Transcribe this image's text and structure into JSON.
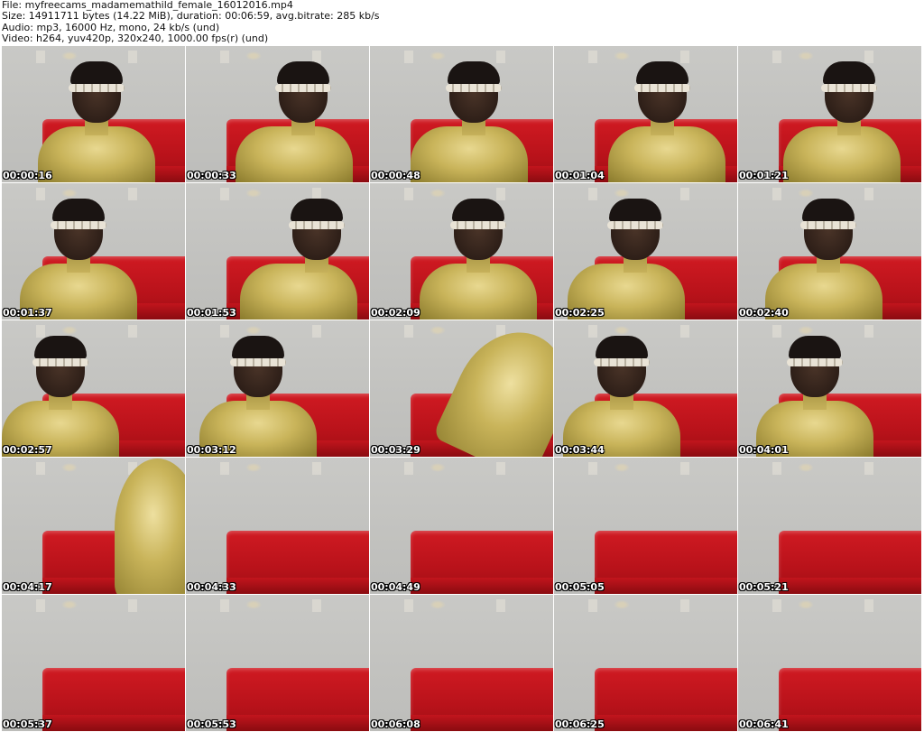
{
  "header": {
    "file_line": "File: myfreecams_madamemathild_female_16012016.mp4",
    "size_line": "Size: 14911711 bytes (14.22 MiB), duration: 00:06:59, avg.bitrate: 285 kb/s",
    "audio_line": "Audio: mp3, 16000 Hz, mono, 24 kb/s (und)",
    "video_line": "Video: h264, yuv420p, 320x240, 1000.00 fps(r) (und)"
  },
  "thumbnails": [
    {
      "time": "00:00:16",
      "scene": "person"
    },
    {
      "time": "00:00:33",
      "scene": "person"
    },
    {
      "time": "00:00:48",
      "scene": "person"
    },
    {
      "time": "00:01:04",
      "scene": "person"
    },
    {
      "time": "00:01:21",
      "scene": "person"
    },
    {
      "time": "00:01:37",
      "scene": "person"
    },
    {
      "time": "00:01:53",
      "scene": "person"
    },
    {
      "time": "00:02:09",
      "scene": "person"
    },
    {
      "time": "00:02:25",
      "scene": "person"
    },
    {
      "time": "00:02:40",
      "scene": "person"
    },
    {
      "time": "00:02:57",
      "scene": "person"
    },
    {
      "time": "00:03:12",
      "scene": "person"
    },
    {
      "time": "00:03:29",
      "scene": "gold-closeup"
    },
    {
      "time": "00:03:44",
      "scene": "person"
    },
    {
      "time": "00:04:01",
      "scene": "person"
    },
    {
      "time": "00:04:17",
      "scene": "gold-closeup"
    },
    {
      "time": "00:04:33",
      "scene": "empty"
    },
    {
      "time": "00:04:49",
      "scene": "empty"
    },
    {
      "time": "00:05:05",
      "scene": "empty"
    },
    {
      "time": "00:05:21",
      "scene": "empty"
    },
    {
      "time": "00:05:37",
      "scene": "empty"
    },
    {
      "time": "00:05:53",
      "scene": "empty"
    },
    {
      "time": "00:06:08",
      "scene": "empty"
    },
    {
      "time": "00:06:25",
      "scene": "empty"
    },
    {
      "time": "00:06:41",
      "scene": "empty"
    }
  ],
  "colors": {
    "background": "#ffffff",
    "wall": "#c4c4c1",
    "couch": "#c8161e",
    "gold_paint": "#c9b45a",
    "timestamp_text": "#ffffff"
  }
}
